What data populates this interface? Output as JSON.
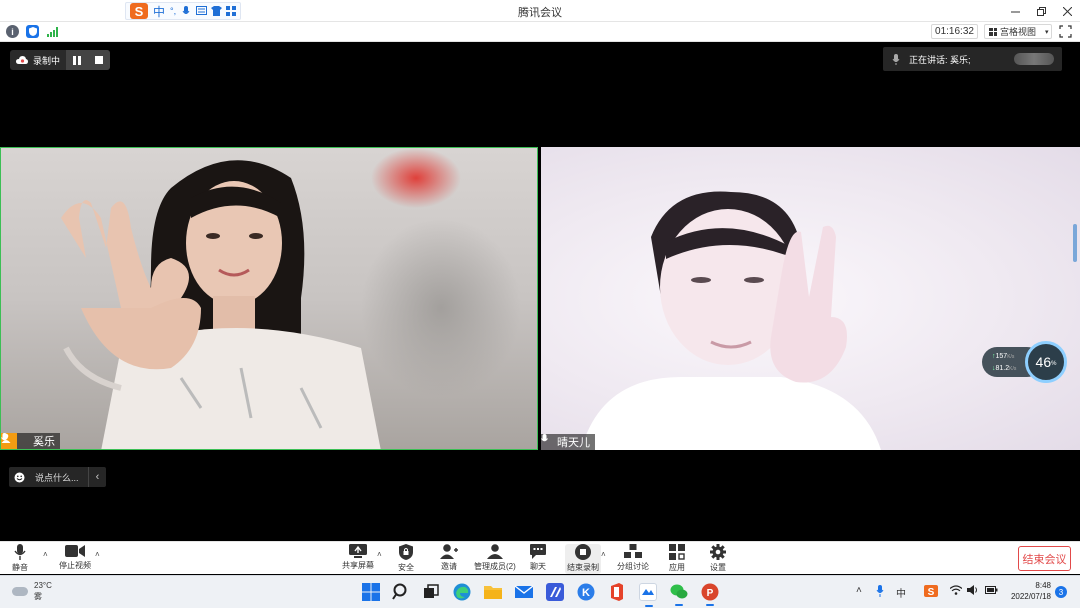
{
  "window": {
    "title": "腾讯会议"
  },
  "ime": {
    "lang": "中",
    "punct": "°,"
  },
  "infobar": {
    "timer": "01:16:32",
    "view_label": "宫格视图"
  },
  "recording": {
    "label": "录制中"
  },
  "speaking": {
    "label": "正在讲话: 奚乐;"
  },
  "participants": [
    {
      "name": "奚乐",
      "is_host": true
    },
    {
      "name": "晴天儿",
      "is_host": false
    }
  ],
  "network": {
    "upload": "157",
    "upload_unit": "K/s",
    "download": "81.2",
    "download_unit": "K/s",
    "cpu": "46",
    "cpu_unit": "%"
  },
  "chat": {
    "placeholder": "说点什么..."
  },
  "toolbar": {
    "mute": "静音",
    "stop_video": "停止视频",
    "share_screen": "共享屏幕",
    "security": "安全",
    "invite": "邀请",
    "manage_members": "管理成员(2)",
    "chat": "聊天",
    "end_recording": "结束录制",
    "breakout": "分组讨论",
    "apps": "应用",
    "settings": "设置",
    "end_meeting": "结束会议"
  },
  "taskbar": {
    "weather_temp": "23°C",
    "weather_desc": "雾",
    "ime_mode": "中",
    "time": "8:48",
    "date": "2022/07/18",
    "notifications": "3"
  },
  "colors": {
    "accent_blue": "#1a73e8",
    "active_speaker_border": "#3cbf55",
    "end_meeting_red": "#e24a4a",
    "host_badge": "#f39c12"
  }
}
